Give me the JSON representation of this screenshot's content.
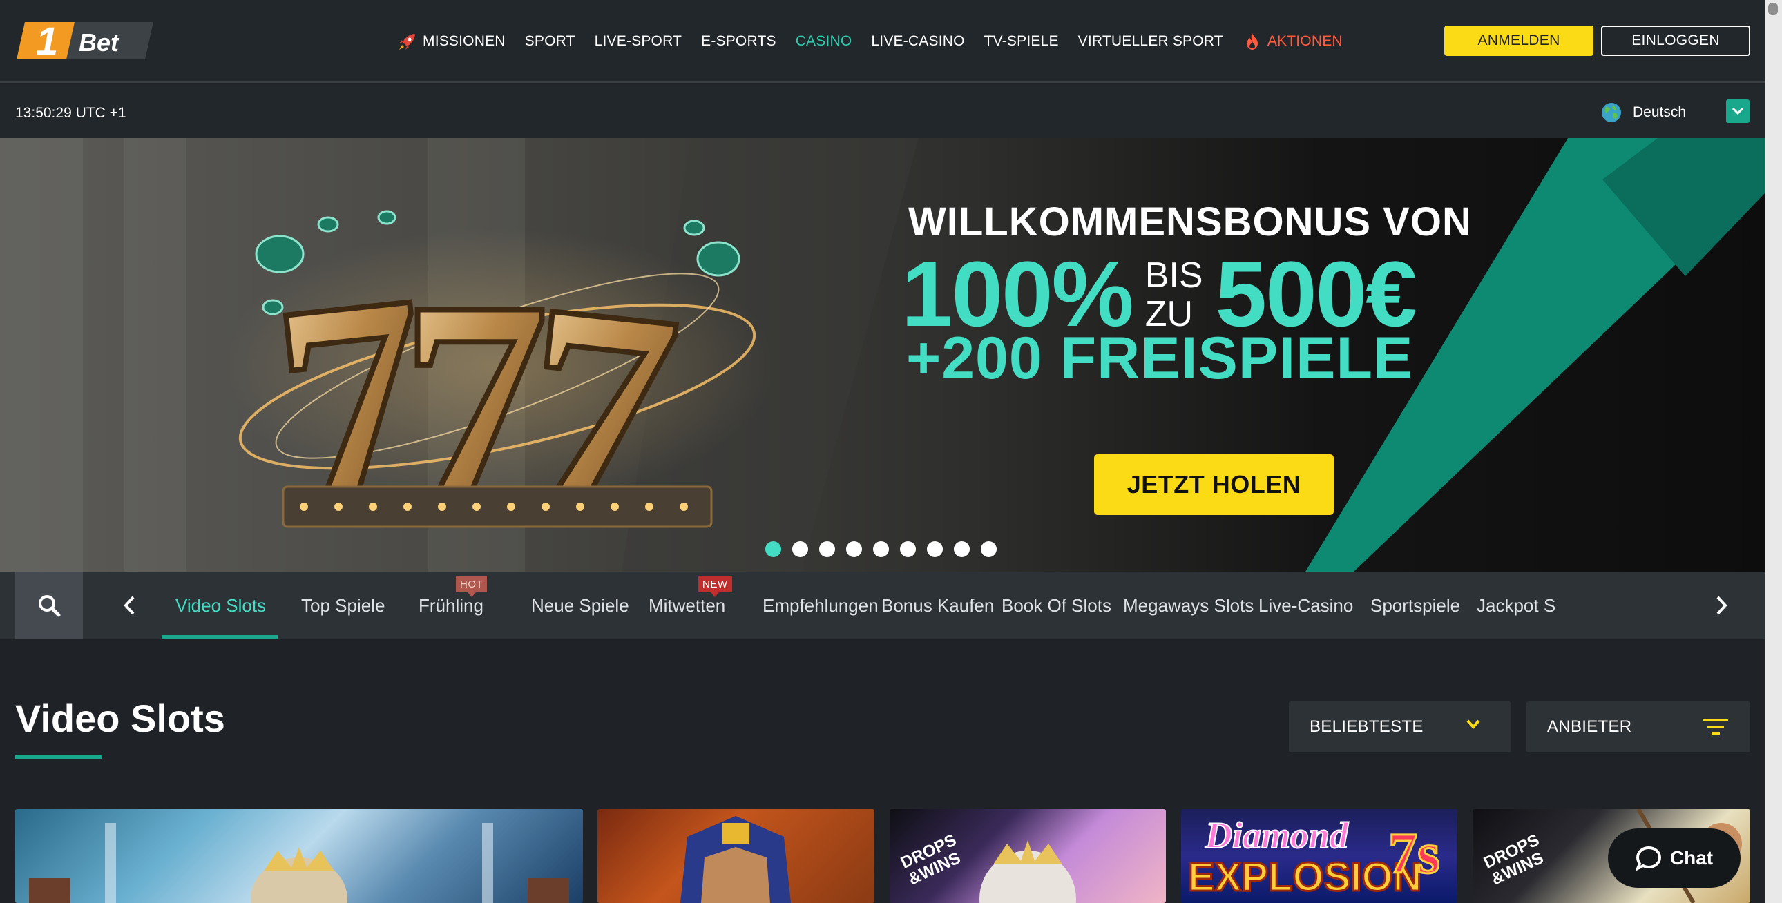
{
  "brand": {
    "logo_digit": "1",
    "logo_text": "Bet"
  },
  "nav": [
    {
      "label": "MISSIONEN",
      "icon": "rocket-icon"
    },
    {
      "label": "SPORT"
    },
    {
      "label": "LIVE-SPORT"
    },
    {
      "label": "E-SPORTS"
    },
    {
      "label": "CASINO",
      "active": true
    },
    {
      "label": "LIVE-CASINO"
    },
    {
      "label": "TV-SPIELE"
    },
    {
      "label": "VIRTUELLER SPORT"
    },
    {
      "label": "AKTIONEN",
      "icon": "flame-icon"
    }
  ],
  "auth": {
    "register": "ANMELDEN",
    "login": "EINLOGGEN"
  },
  "subbar": {
    "time": "13:50:29 UTC +1",
    "language": "Deutsch"
  },
  "banner": {
    "headline": "WILLKOMMENSBONUS VON",
    "percent": "100%",
    "bis": "BIS",
    "zu": "ZU",
    "amount": "500€",
    "freespins": "+200 FREISPIELE",
    "cta": "JETZT HOLEN",
    "slide_count": 9,
    "active_slide": 1
  },
  "categories": [
    {
      "label": "Video Slots",
      "active": true
    },
    {
      "label": "Top Spiele"
    },
    {
      "label": "Frühling",
      "badge": "HOT"
    },
    {
      "label": "Neue Spiele"
    },
    {
      "label": "Mitwetten",
      "badge": "NEW"
    },
    {
      "label": "Empfehlungen"
    },
    {
      "label": "Bonus Kaufen"
    },
    {
      "label": "Book Of Slots"
    },
    {
      "label": "Megaways Slots"
    },
    {
      "label": "Live-Casino"
    },
    {
      "label": "Sportspiele"
    },
    {
      "label": "Jackpot S"
    }
  ],
  "section": {
    "title": "Video Slots",
    "sort_label": "BELIEBTESTE",
    "provider_label": "ANBIETER"
  },
  "tiles": [
    {
      "badge": ""
    },
    {
      "badge": ""
    },
    {
      "badge": "DROPS & WINS",
      "badge_l1": "DROPS",
      "badge_l2": "&WINS"
    },
    {
      "title1": "Diamond",
      "title2": "EXPLOSION",
      "title3": "7s"
    },
    {
      "badge": "DROPS & WINS",
      "badge_l1": "DROPS",
      "badge_l2": "&WINS"
    }
  ],
  "chat": {
    "label": "Chat"
  },
  "colors": {
    "accent": "#43ddc4",
    "accent_dark": "#1aa88d",
    "yellow": "#fadb16",
    "promo": "#ff5a3d",
    "bg": "#1f2327"
  }
}
